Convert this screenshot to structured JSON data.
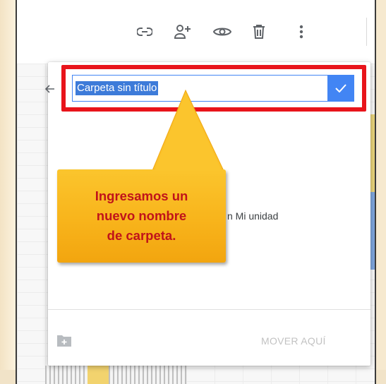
{
  "toolbar": {
    "icons": [
      "link-icon",
      "add-person-icon",
      "eye-icon",
      "trash-icon",
      "more-vert-icon"
    ]
  },
  "dialog": {
    "folder_name_value": "Carpeta sin título",
    "location_text": "n Mi unidad",
    "move_here_label": "MOVER AQUÍ"
  },
  "callout": {
    "line1": "Ingresamos un",
    "line2": "nuevo nombre",
    "line3": "de carpeta."
  },
  "colors": {
    "highlight_border": "#e8141b",
    "callout_fill": "#f8b41b",
    "callout_text": "#c0131a",
    "accent_blue": "#4285f4"
  }
}
